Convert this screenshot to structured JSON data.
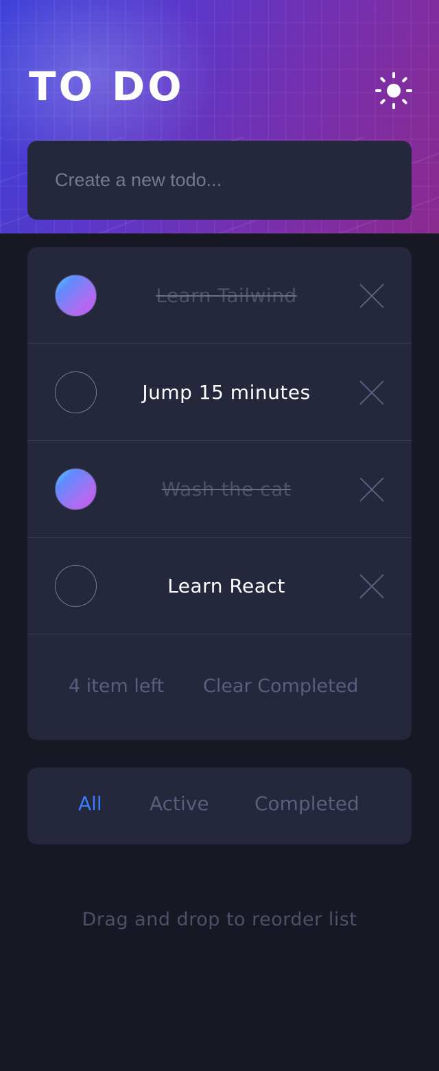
{
  "header": {
    "title": "TO DO",
    "theme_toggle_icon": "sun-icon"
  },
  "new_todo": {
    "placeholder": "Create a new todo...",
    "value": ""
  },
  "todos": [
    {
      "text": "Learn Tailwind",
      "completed": true
    },
    {
      "text": "Jump 15 minutes",
      "completed": false
    },
    {
      "text": "Wash the cat",
      "completed": true
    },
    {
      "text": "Learn React",
      "completed": false
    }
  ],
  "footer": {
    "items_left": "4 item left",
    "clear_label": "Clear Completed"
  },
  "filters": {
    "all": "All",
    "active": "Active",
    "completed": "Completed",
    "selected": "All"
  },
  "hint": "Drag and drop to reorder list",
  "colors": {
    "background": "#171823",
    "card": "#25273d",
    "accent": "#3a7cfd",
    "check_gradient_start": "#55ddff",
    "check_gradient_end": "#c058f3"
  },
  "icons": {
    "delete": "close-icon",
    "check": "check-circle-icon"
  }
}
